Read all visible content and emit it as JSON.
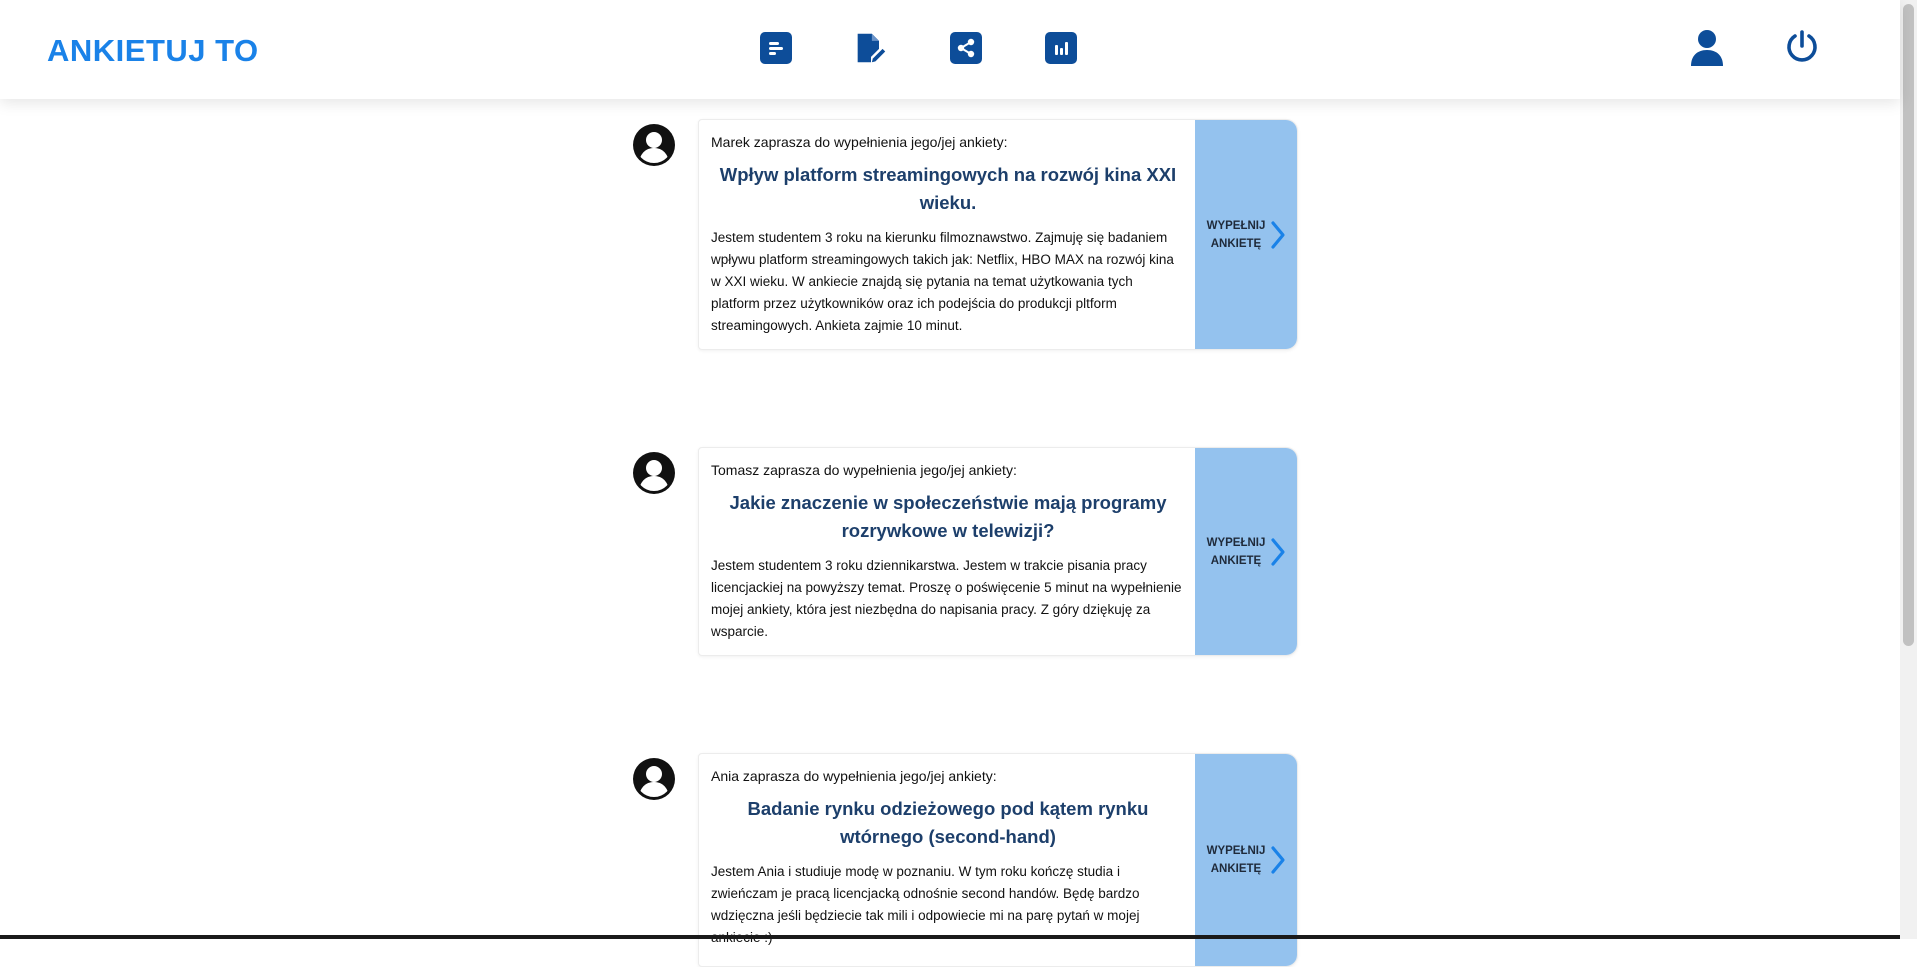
{
  "header": {
    "brand": "ANKIETUJ TO",
    "nav": [
      {
        "icon": "poll-list-icon"
      },
      {
        "icon": "edit-document-icon"
      },
      {
        "icon": "share-icon"
      },
      {
        "icon": "bar-chart-icon"
      }
    ],
    "right_icons": [
      "user-profile-icon",
      "power-logout-icon"
    ]
  },
  "colors": {
    "brand": "#1a82e8",
    "nav_button": "#0d4d99",
    "fill_button": "#94c2ee",
    "title": "#1d3f6b"
  },
  "surveys": [
    {
      "intro": "Marek zaprasza do wypełnienia jego/jej ankiety:",
      "title": "Wpływ platform streamingowych na rozwój kina XXI wieku.",
      "description": "Jestem studentem 3 roku na kierunku filmoznawstwo. Zajmuję się badaniem wpływu platform streamingowych takich jak: Netflix, HBO MAX na rozwój kina w XXI wieku. W ankiecie znajdą się pytania na temat użytkowania tych platform przez użytkowników oraz ich podejścia do produkcji pltform streamingowych. Ankieta zajmie 10 minut.",
      "button_label": "WYPEŁNIJ ANKIETĘ"
    },
    {
      "intro": "Tomasz zaprasza do wypełnienia jego/jej ankiety:",
      "title": "Jakie znaczenie w społeczeństwie mają programy rozrywkowe w telewizji?",
      "description": "Jestem studentem 3 roku dziennikarstwa. Jestem w trakcie pisania pracy licencjackiej na powyższy temat. Proszę o poświęcenie 5 minut na wypełnienie mojej ankiety, która jest niezbędna do napisania pracy. Z góry dziękuję za wsparcie.",
      "button_label": "WYPEŁNIJ ANKIETĘ"
    },
    {
      "intro": "Ania zaprasza do wypełnienia jego/jej ankiety:",
      "title": "Badanie rynku odzieżowego pod kątem rynku wtórnego (second-hand)",
      "description": "Jestem Ania i studiuje modę w poznaniu. W tym roku kończę studia i zwieńczam je pracą licencjacką odnośnie second handów. Będę bardzo wdzięczna jeśli będziecie tak mili i odpowiecie mi na parę pytań w mojej ankiecie :)",
      "button_label": "WYPEŁNIJ ANKIETĘ"
    }
  ]
}
